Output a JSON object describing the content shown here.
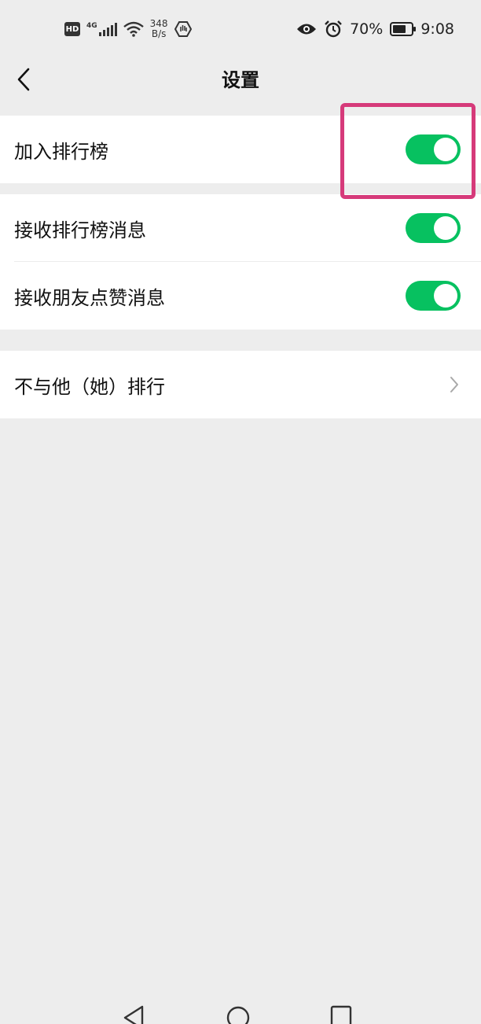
{
  "status_bar": {
    "hd_badge": "HD",
    "network_type": "4G",
    "net_speed_value": "348",
    "net_speed_unit": "B/s",
    "battery_percent": "70%",
    "battery_level": 0.7,
    "time": "9:08",
    "icons": [
      "hd-icon",
      "signal-icon",
      "wifi-icon",
      "hand-icon",
      "eye-icon",
      "alarm-icon",
      "battery-icon"
    ]
  },
  "nav": {
    "title": "设置",
    "back_icon": "chevron-left-icon"
  },
  "settings": {
    "group1": [
      {
        "label": "加入排行榜",
        "enabled": true
      }
    ],
    "group2": [
      {
        "label": "接收排行榜消息",
        "enabled": true
      },
      {
        "label": "接收朋友点赞消息",
        "enabled": true
      }
    ],
    "group3": [
      {
        "label": "不与他（她）排行",
        "chevron_icon": "chevron-right-icon"
      }
    ]
  },
  "colors": {
    "toggle_on": "#07c160",
    "highlight": "#d63a7a",
    "background": "#ededed"
  },
  "system_nav_icons": [
    "back-triangle-icon",
    "home-circle-icon",
    "recents-square-icon"
  ]
}
